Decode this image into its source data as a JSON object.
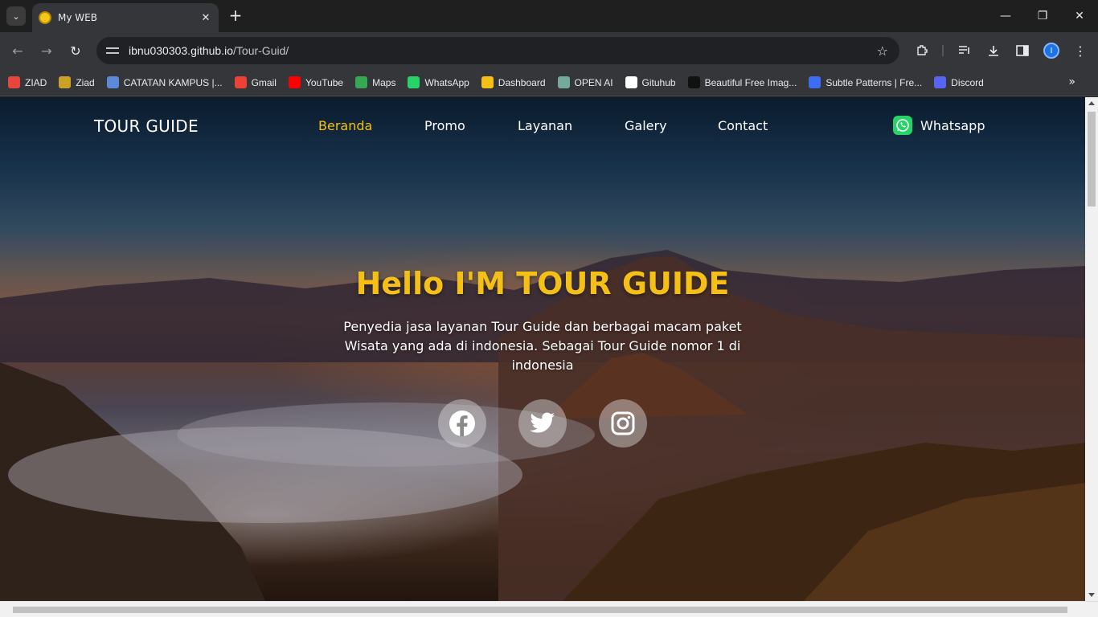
{
  "browser": {
    "tab_title": "My WEB",
    "url_host": "ibnu030303.github.io",
    "url_path": "/Tour-Guid/",
    "profile_initial": "I",
    "bookmarks": [
      {
        "label": "ZIAD",
        "icon": "bookmark-ziad-icon",
        "color": "#e8453c"
      },
      {
        "label": "Ziad",
        "icon": "medal-icon",
        "color": "#c9a227"
      },
      {
        "label": "CATATAN KAMPUS |...",
        "icon": "notes-icon",
        "color": "#5c8ad6"
      },
      {
        "label": "Gmail",
        "icon": "gmail-icon",
        "color": "#ea4335"
      },
      {
        "label": "YouTube",
        "icon": "youtube-icon",
        "color": "#ff0000"
      },
      {
        "label": "Maps",
        "icon": "maps-icon",
        "color": "#34a853"
      },
      {
        "label": "WhatsApp",
        "icon": "whatsapp-icon",
        "color": "#25d366"
      },
      {
        "label": "Dashboard",
        "icon": "dashboard-icon",
        "color": "#f4c017"
      },
      {
        "label": "OPEN AI",
        "icon": "openai-icon",
        "color": "#74aa9c"
      },
      {
        "label": "Gituhub",
        "icon": "github-icon",
        "color": "#ffffff"
      },
      {
        "label": "Beautiful Free Imag...",
        "icon": "unsplash-icon",
        "color": "#111111"
      },
      {
        "label": "Subtle Patterns | Fre...",
        "icon": "patterns-icon",
        "color": "#3d6df2"
      },
      {
        "label": "Discord",
        "icon": "discord-icon",
        "color": "#5865f2"
      }
    ]
  },
  "page": {
    "brand": "TOUR GUIDE",
    "nav": [
      "Beranda",
      "Promo",
      "Layanan",
      "Galery",
      "Contact"
    ],
    "active_nav": "Beranda",
    "whatsapp_label": "Whatsapp",
    "hero_title": "Hello I'M TOUR GUIDE",
    "hero_text": "Penyedia jasa layanan Tour Guide dan berbagai macam paket Wisata yang ada di indonesia. Sebagai Tour Guide nomor 1 di indonesia",
    "social": [
      "facebook-icon",
      "twitter-icon",
      "instagram-icon"
    ],
    "accent_color": "#f4c017"
  }
}
